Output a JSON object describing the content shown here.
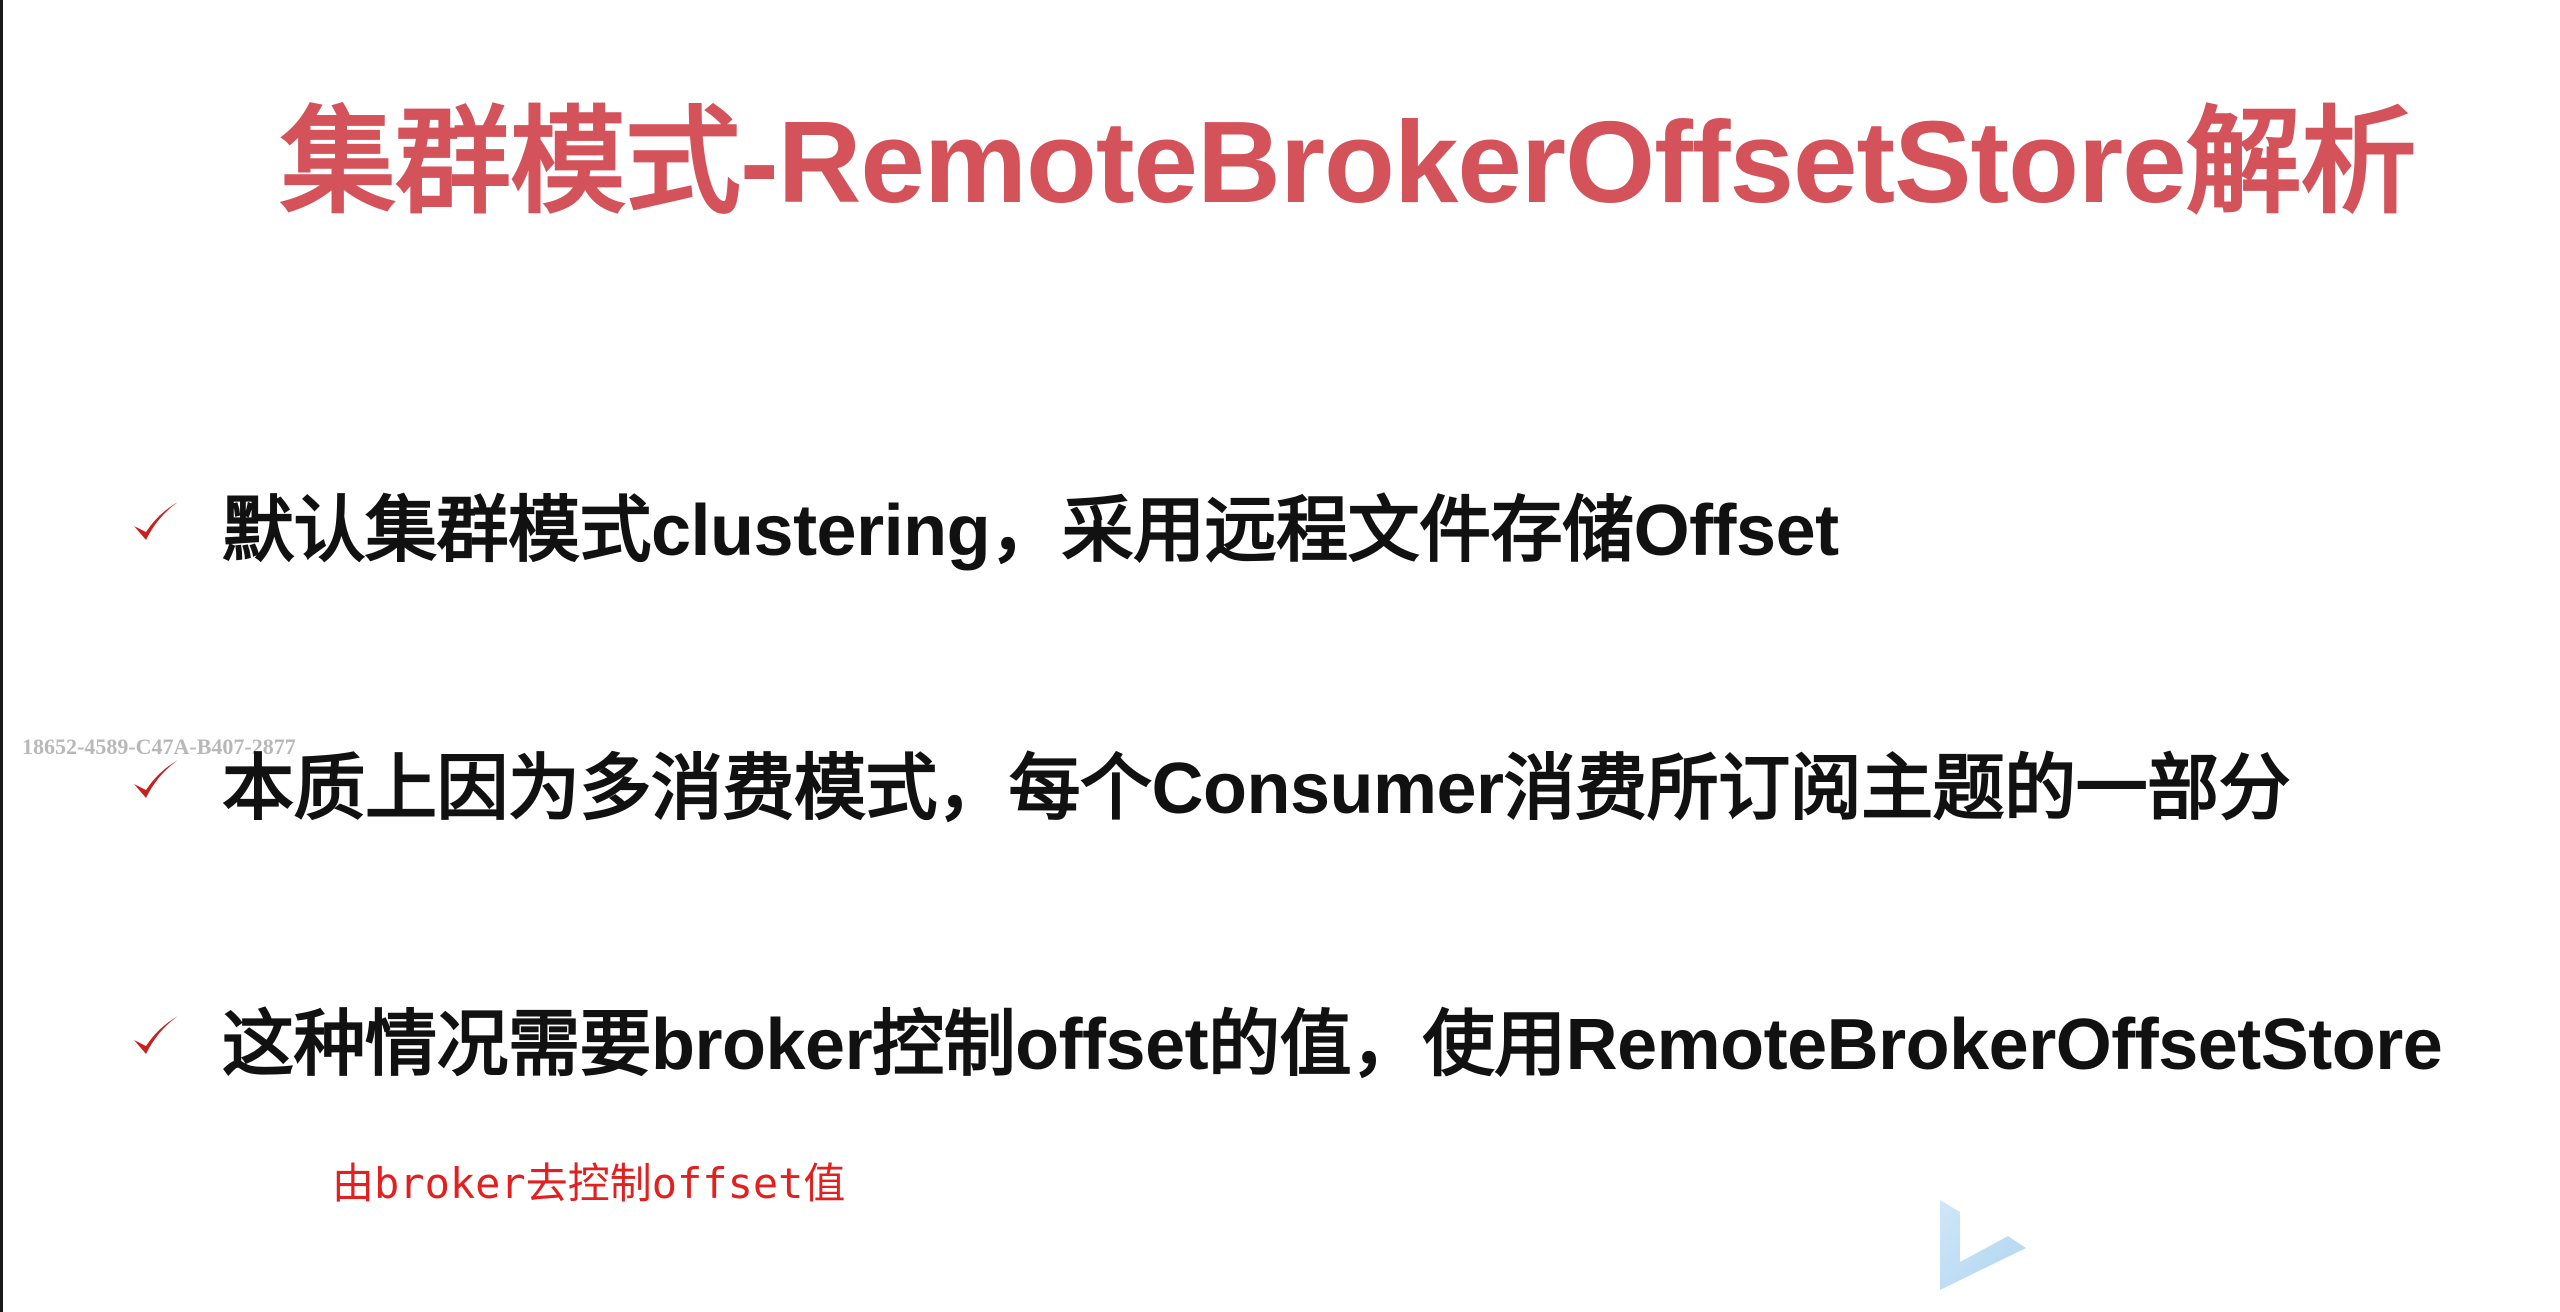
{
  "slide": {
    "title": "集群模式-RemoteBrokerOffsetStore解析",
    "title_color": "#d4525a",
    "check_color": "#c8201e",
    "bullets": [
      "默认集群模式clustering，采用远程文件存储Offset",
      "本质上因为多消费模式，每个Consumer消费所订阅主题的一部分",
      "这种情况需要broker控制offset的值，使用RemoteBrokerOffsetStore"
    ],
    "note": "由broker去控制offset值",
    "note_color": "#e22020",
    "watermark": "18652-4589-C47A-B407-2877",
    "icons": {
      "bullet": "checkmark-icon",
      "corner_logo": "play-logo-icon"
    }
  }
}
